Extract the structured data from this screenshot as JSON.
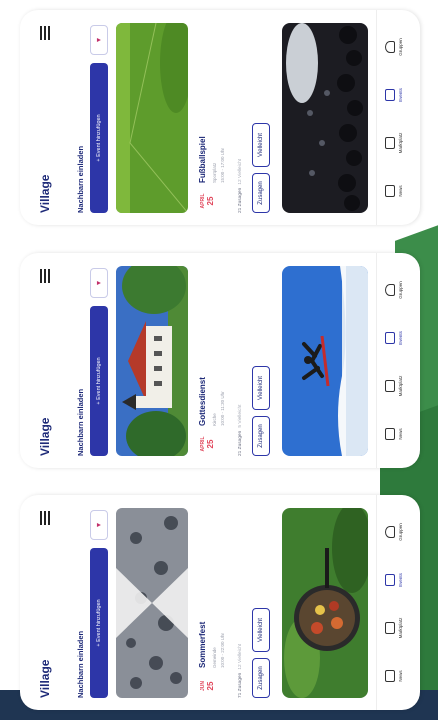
{
  "app_title": "Village",
  "invite_label": "Nachbarn einladen",
  "add_event_label": "+ Event hinzufügen",
  "filter_icon": "filter-icon",
  "nav": [
    {
      "label": "News",
      "icon": "newspaper-icon"
    },
    {
      "label": "Marktplatz",
      "icon": "marketplace-icon"
    },
    {
      "label": "Events",
      "icon": "calendar-icon"
    },
    {
      "label": "Gruppen",
      "icon": "group-icon"
    }
  ],
  "screens": [
    {
      "event": {
        "month": "JUN",
        "day": "25",
        "title": "Sommerfest",
        "sub1": "Gemeinde",
        "sub2": "10:00 - 22:00 Uhr",
        "stats_zusagen": "71 Zusagen",
        "stats_vielleicht": "12 Vielleicht",
        "btn_zusagen": "Zusagen",
        "btn_vielleicht": "Vielleicht"
      }
    },
    {
      "event": {
        "month": "APRIL",
        "day": "25",
        "title": "Gottesdienst",
        "sub1": "Kirche",
        "sub2": "10:00 - 11:30 Uhr",
        "stats_zusagen": "21 Zusagen",
        "stats_vielleicht": "5 Vielleicht",
        "btn_zusagen": "Zusagen",
        "btn_vielleicht": "Vielleicht"
      }
    },
    {
      "event": {
        "month": "APRIL",
        "day": "25",
        "title": "Fußballspiel",
        "sub1": "Sportplatz",
        "sub2": "15:00 - 17:00 Uhr",
        "stats_zusagen": "21 Zusagen",
        "stats_vielleicht": "12 Vielleicht",
        "btn_zusagen": "Zusagen",
        "btn_vielleicht": "Vielleicht"
      }
    }
  ],
  "colors": {
    "accent": "#2d36a8",
    "title": "#1e2a78",
    "date": "#e0455a"
  }
}
